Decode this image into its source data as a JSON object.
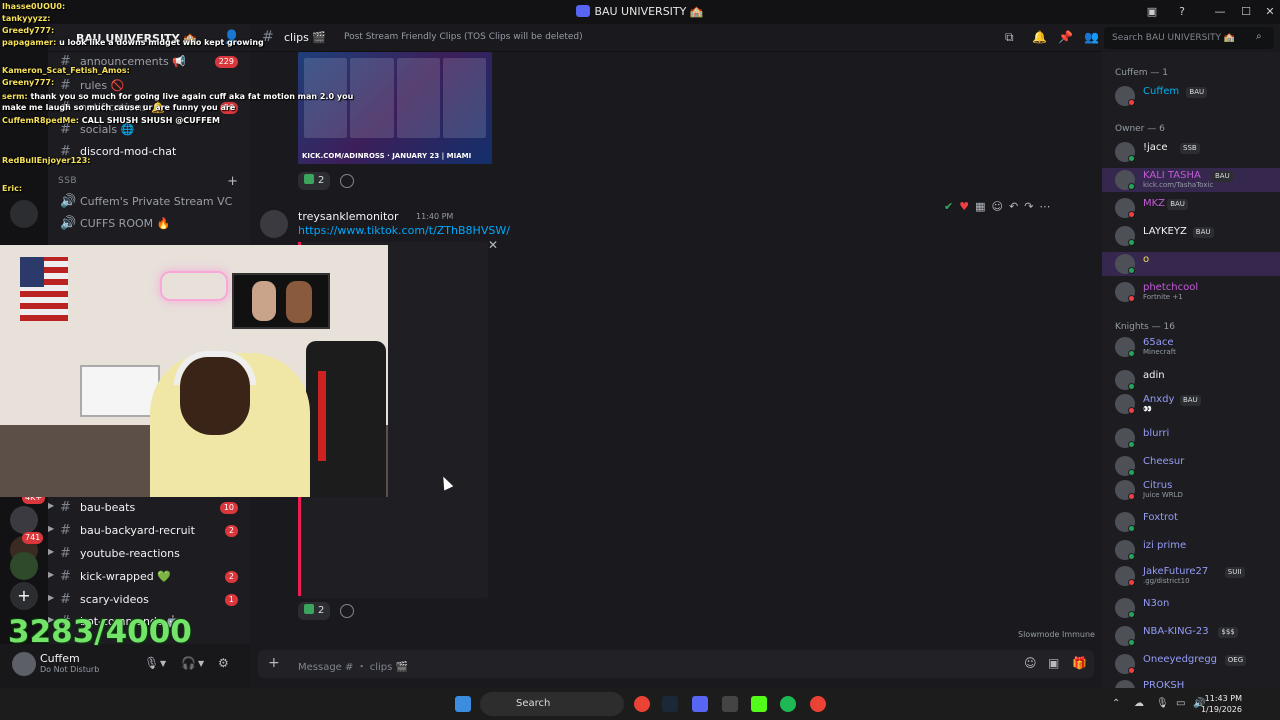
{
  "window": {
    "title": "BAU UNIVERSITY 🏫"
  },
  "server": {
    "name": "BAU UNIVERSITY 🏫"
  },
  "channels": [
    {
      "name": "announcements 📢",
      "badge": "229"
    },
    {
      "name": "notifications 🔔",
      "badge": "56"
    },
    {
      "name": "rules 🚫"
    },
    {
      "name": "socials 🌐"
    },
    {
      "name": "discord-mod-chat"
    },
    {
      "name": "Cuffem's Private Stream VC"
    },
    {
      "name": "CUFFS ROOM 🔥"
    },
    {
      "name": "bau-beats",
      "badge": "10"
    },
    {
      "name": "bau-backyard-recruit",
      "badge": "2"
    },
    {
      "name": "youtube-reactions"
    },
    {
      "name": "kick-wrapped 💚",
      "badge": "2"
    },
    {
      "name": "scary-videos",
      "badge": "1"
    },
    {
      "name": "bot-commands 🤖"
    }
  ],
  "category_ssb": "SSB",
  "rail_badges": [
    "4K+",
    "741"
  ],
  "user": {
    "name": "Cuffem",
    "status": "Do Not Disturb"
  },
  "chat": {
    "channel": "clips 🎬",
    "topic": "Post Stream Friendly Clips (TOS Clips will be deleted)",
    "search_placeholder": "Search BAU UNIVERSITY 🏫",
    "poster_text": "KICK.COM/ADINROSS · JANUARY 23 | MIAMI",
    "reaction1_count": "2",
    "author": "treysanklemonitor",
    "time": "11:40 PM",
    "link": "https://www.tiktok.com/t/ZThB8HVSW/",
    "reaction2_count": "2",
    "slowmode": "Slowmode Immune",
    "composer_placeholder": "Message # ・ clips 🎬"
  },
  "members": {
    "group1": "Cuffem — 1",
    "group2": "Owner — 6",
    "group3": "Knights — 16",
    "list": [
      {
        "name": "Cuffem",
        "color": "#00b0f4",
        "tag": "BAU"
      },
      {
        "name": "!jace",
        "color": "#f2f3f5",
        "tag": "SSB"
      },
      {
        "name": "KALI TASHA",
        "color": "#c45ad8",
        "sub": "kick.com/TashaToxic",
        "tag": "BAU"
      },
      {
        "name": "MKZ",
        "color": "#c45ad8",
        "tag": "BAU"
      },
      {
        "name": "LAYKEYZ",
        "color": "#f2f3f5",
        "tag": "BAU"
      },
      {
        "name": "o",
        "color": "#f5e05a"
      },
      {
        "name": "phetchcool",
        "color": "#c45ad8",
        "sub": "Fortnite +1"
      },
      {
        "name": "65ace",
        "color": "#949cf7",
        "sub": "Minecraft"
      },
      {
        "name": "adin",
        "color": "#f2f3f5"
      },
      {
        "name": "Anxdy",
        "color": "#949cf7",
        "tag": "BAU",
        "sub": "👀"
      },
      {
        "name": "blurri",
        "color": "#949cf7"
      },
      {
        "name": "Cheesur",
        "color": "#949cf7"
      },
      {
        "name": "Citrus",
        "color": "#949cf7",
        "sub": "Juice WRLD"
      },
      {
        "name": "Foxtrot",
        "color": "#949cf7"
      },
      {
        "name": "izi prime",
        "color": "#949cf7"
      },
      {
        "name": "JakeFuture27",
        "color": "#949cf7",
        "tag": "SUII",
        "sub": ".gg/district10"
      },
      {
        "name": "N3on",
        "color": "#949cf7"
      },
      {
        "name": "NBA-KING-23",
        "color": "#949cf7",
        "tag": "$$$"
      },
      {
        "name": "Oneeyedgregg",
        "color": "#949cf7",
        "tag": "OEG"
      },
      {
        "name": "PROKSH",
        "color": "#949cf7"
      }
    ]
  },
  "stream": {
    "goal": "3283/4000",
    "chat": [
      {
        "user": "Ihasse0UOU0:",
        "msg": ""
      },
      {
        "user": "tankyyyzz:",
        "msg": ""
      },
      {
        "user": "Greedy777:",
        "msg": ""
      },
      {
        "user": "papagamer:",
        "msg": "u look like a downs midget who kept growing"
      },
      {
        "user": "Kameron_Scat_Fetish_Amos:",
        "msg": ""
      },
      {
        "user": "Greeny777:",
        "msg": ""
      },
      {
        "user": "serm:",
        "msg": "thank you so much for going live again cuff aka fat motion man 2.0 you"
      },
      {
        "user": "",
        "msg": "make me laugh so much cause ur are funny you are"
      },
      {
        "user": "CuffemR8pedMe:",
        "msg": "CALL SHUSH SHUSH @CUFFEM"
      },
      {
        "user": "Eric:",
        "msg": ""
      },
      {
        "user": "RedBullEnjoyer123:",
        "msg": ""
      }
    ]
  },
  "taskbar": {
    "search": "Search",
    "time": "11:43 PM",
    "date": "1/19/2026"
  },
  "colors": {
    "accent": "#5865f2",
    "danger": "#da373c",
    "online": "#23a55a",
    "dnd": "#f23f43",
    "stream_goal": "#74e36a"
  }
}
